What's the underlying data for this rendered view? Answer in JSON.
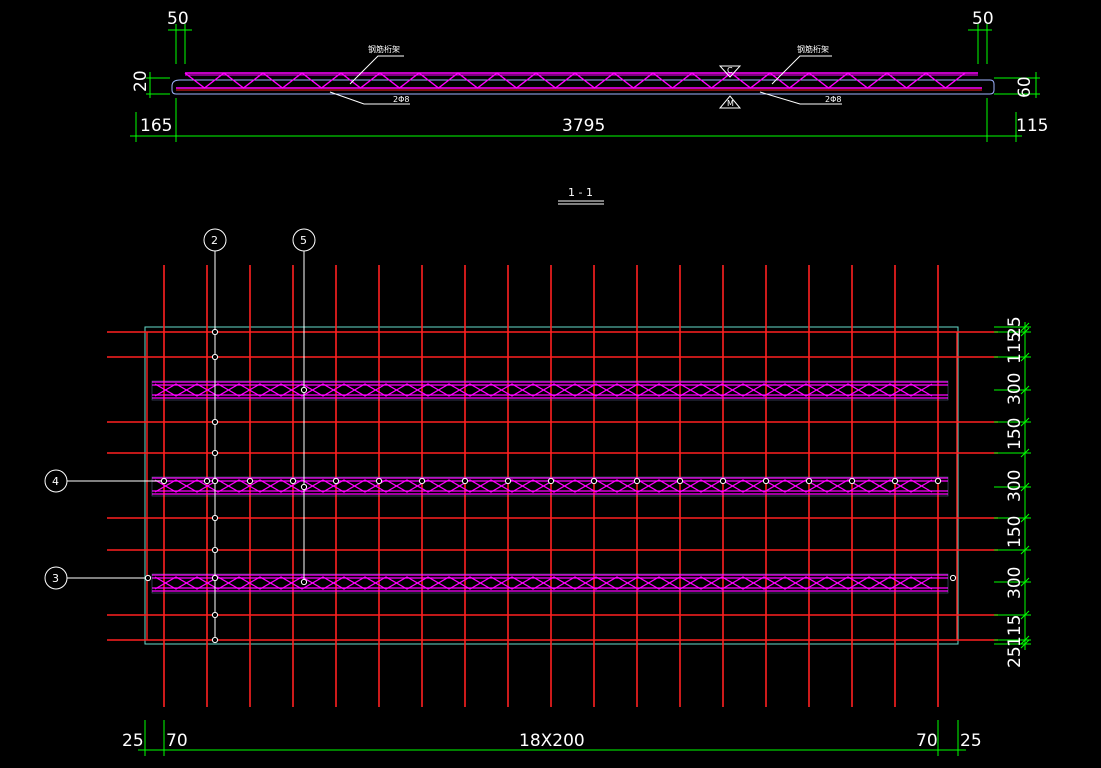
{
  "colors": {
    "background": "#000000",
    "dimension": "#00ff00",
    "rebar": "#ff2020",
    "truss": "#ff00ff",
    "leader": "#ffffff",
    "slab_outline": "#66ddcc",
    "truss_outline": "#9fb4ff"
  },
  "elevation": {
    "top_dims": [
      "50",
      "50"
    ],
    "left_height": "20",
    "right_height": "60",
    "bottom_dims": [
      "165",
      "3795",
      "115"
    ],
    "callouts": {
      "left_upper": "钢筋桁架",
      "left_lower": "2Φ8",
      "right_upper": "钢筋桁架",
      "right_lower": "2Φ8"
    },
    "marker_symbols": [
      "C",
      "M"
    ]
  },
  "section_title": "1 - 1",
  "plan": {
    "bubbles": {
      "two": "2",
      "five": "5",
      "four": "4",
      "three": "3"
    },
    "right_dims": [
      "25",
      "115",
      "300",
      "150",
      "300",
      "150",
      "300",
      "115",
      "25"
    ],
    "bottom_dims": [
      "25",
      "70",
      "18X200",
      "70",
      "25"
    ]
  }
}
